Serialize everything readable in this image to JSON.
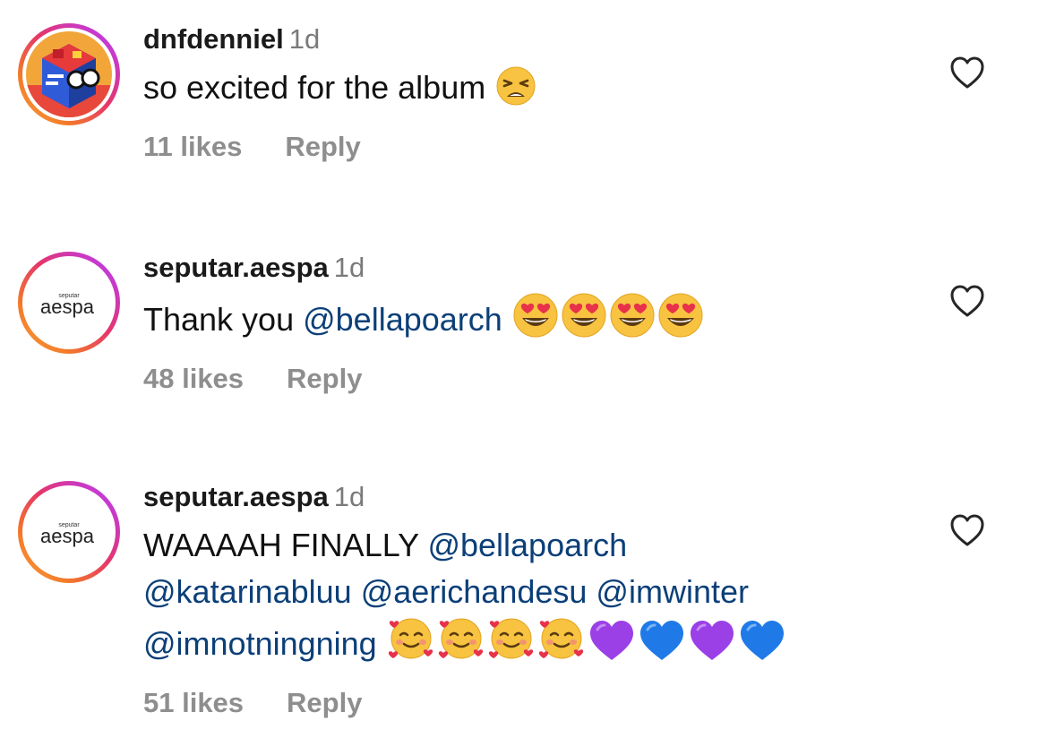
{
  "comments": [
    {
      "username": "dnfdenniel",
      "time": "1d",
      "segments": [
        {
          "text": "so excited for the album"
        }
      ],
      "emojis": [
        "tired-face"
      ],
      "likes": "11 likes",
      "reply": "Reply"
    },
    {
      "username": "seputar.aespa",
      "time": "1d",
      "avatar_small_text": "seputar",
      "avatar_text": "aespa",
      "segments": [
        {
          "text": "Thank you "
        },
        {
          "mention": "@bellapoarch"
        }
      ],
      "emojis": [
        "heart-eyes",
        "heart-eyes",
        "heart-eyes",
        "heart-eyes"
      ],
      "likes": "48 likes",
      "reply": "Reply"
    },
    {
      "username": "seputar.aespa",
      "time": "1d",
      "avatar_small_text": "seputar",
      "avatar_text": "aespa",
      "line1_text": "WAAAAH FINALLY ",
      "mentions": [
        "@bellapoarch",
        "@katarinabluu",
        "@aerichandesu",
        "@imwinter",
        "@imnotningning"
      ],
      "emojis": [
        "smiling-hearts",
        "smiling-hearts",
        "smiling-hearts",
        "smiling-hearts",
        "purple-heart",
        "blue-heart",
        "purple-heart",
        "blue-heart"
      ],
      "likes": "51 likes",
      "reply": "Reply"
    }
  ],
  "colors": {
    "mention": "#0b3f78",
    "meta": "#8e8e8e",
    "time": "#7a7a7a",
    "ring_start": "#f9a13a",
    "ring_end": "#b535e0"
  },
  "icons": {
    "like": "heart-outline-icon"
  }
}
